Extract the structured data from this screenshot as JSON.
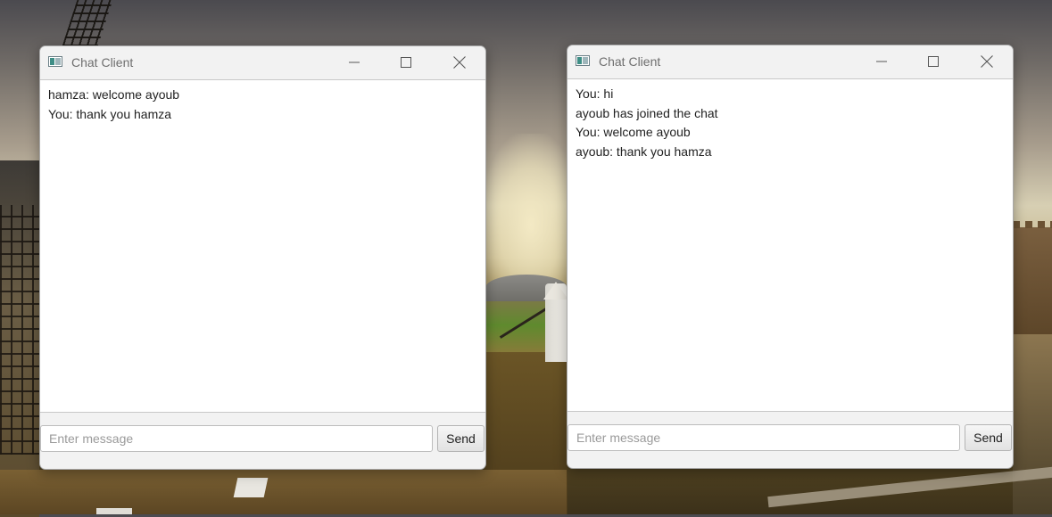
{
  "icons": {
    "app": "chat-app-icon",
    "minimize": "minimize-icon",
    "maximize": "maximize-icon",
    "close": "close-icon"
  },
  "windows": [
    {
      "title": "Chat Client",
      "messages": [
        "hamza: welcome ayoub",
        "You: thank you hamza"
      ],
      "input_placeholder": "Enter message",
      "input_value": "",
      "send_label": "Send"
    },
    {
      "title": "Chat Client",
      "messages": [
        "You: hi",
        "ayoub has joined the chat",
        "You: welcome ayoub",
        "ayoub: thank you hamza"
      ],
      "input_placeholder": "Enter message",
      "input_value": "",
      "send_label": "Send"
    }
  ]
}
